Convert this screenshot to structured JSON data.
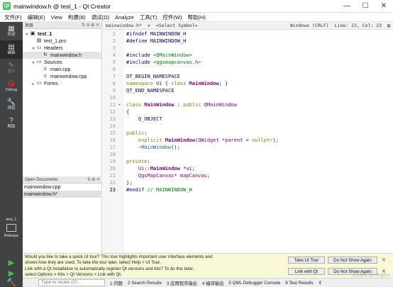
{
  "window": {
    "title": "mainwindow.h @ test_1 - Qt Creator",
    "minimize": "—",
    "maximize": "☐",
    "close": "✕"
  },
  "menu": [
    "文件(F)",
    "编辑(E)",
    "View",
    "构建(B)",
    "调试(D)",
    "Analyze",
    "工具(T)",
    "控件(W)",
    "帮助(H)"
  ],
  "modes": [
    {
      "icon": "▦",
      "label": "欢迎"
    },
    {
      "icon": "▤",
      "label": "编辑"
    },
    {
      "icon": "✎",
      "label": "设计"
    },
    {
      "icon": "🐞",
      "label": "Debug"
    },
    {
      "icon": "🔧",
      "label": "项目"
    },
    {
      "icon": "?",
      "label": "帮助"
    }
  ],
  "kit": {
    "project": "test_1",
    "config": "Release"
  },
  "run_buttons": [
    "▶",
    "▶",
    "🔨"
  ],
  "projects_panel": {
    "header": "项目",
    "header_icons": "⇅ ⊖ ⊞ ✕"
  },
  "tree": [
    {
      "label": "test_1",
      "arrow": "▾",
      "icon": "▣",
      "indent": 0,
      "bold": true
    },
    {
      "label": "test_1.pro",
      "arrow": "",
      "icon": "▤",
      "indent": 1
    },
    {
      "label": "Headers",
      "arrow": "▾",
      "icon": "▭",
      "indent": 1
    },
    {
      "label": "mainwindow.h",
      "arrow": "",
      "icon": "h",
      "indent": 2,
      "selected": true
    },
    {
      "label": "Sources",
      "arrow": "▾",
      "icon": "▭",
      "indent": 1
    },
    {
      "label": "main.cpp",
      "arrow": "",
      "icon": "c",
      "indent": 2
    },
    {
      "label": "mainwindow.cpp",
      "arrow": "",
      "icon": "c",
      "indent": 2
    },
    {
      "label": "Forms",
      "arrow": "▸",
      "icon": "▭",
      "indent": 1
    }
  ],
  "open_docs": {
    "header": "Open Documents",
    "header_icons": "⇅ ⊞ ✕",
    "items": [
      "mainwindow.cpp",
      "mainwindow.h*"
    ]
  },
  "editor": {
    "tab": "mainwindow.h*",
    "symbol": "<Select Symbol>",
    "encoding": "Windows (CRLF)",
    "position": "Line: 23, Col: 23",
    "current_line": 23,
    "lines": [
      "#ifndef MAINWINDOW_H",
      "#define MAINWINDOW_H",
      "",
      "#include <QMainWindow>",
      "#include <qgsmapcanvas.h>",
      "",
      "QT_BEGIN_NAMESPACE",
      "namespace Ui { class MainWindow; }",
      "QT_END_NAMESPACE",
      "",
      "class MainWindow : public QMainWindow",
      "{",
      "    Q_OBJECT",
      "",
      "public:",
      "    explicit MainWindow(QWidget *parent = nullptr);",
      "    ~MainWindow();",
      "",
      "private:",
      "    Ui::MainWindow *ui;",
      "    QgsMapCanvas* mapCanvas;",
      "};",
      "#endif // MAINWINDOW_H"
    ]
  },
  "notification": {
    "line1": "Would you like to take a quick UI tour? This tour highlights important user interface elements and",
    "line2": "shows how they are used. To take the tour later, select Help > UI Tour.",
    "line3": "Link with a Qt installation to automatically register Qt versions and kits? To do this later,",
    "line4": "select Options > Kits > Qt Versions > Link with Qt.",
    "take_tour": "Take UI Tour",
    "dont_show_1": "Do Not Show Again",
    "link_qt": "Link with Qt",
    "dont_show_2": "Do Not Show Again"
  },
  "statusbar": {
    "locate_placeholder": "Type to locate (Ct...",
    "panes": [
      "1 问题",
      "2 Search Results",
      "3 应用程序输出",
      "4 编译输出",
      "5 QML Debugger Console",
      "8 Test Results",
      "⇕"
    ]
  },
  "watermark": "CSDN @rongfyu"
}
